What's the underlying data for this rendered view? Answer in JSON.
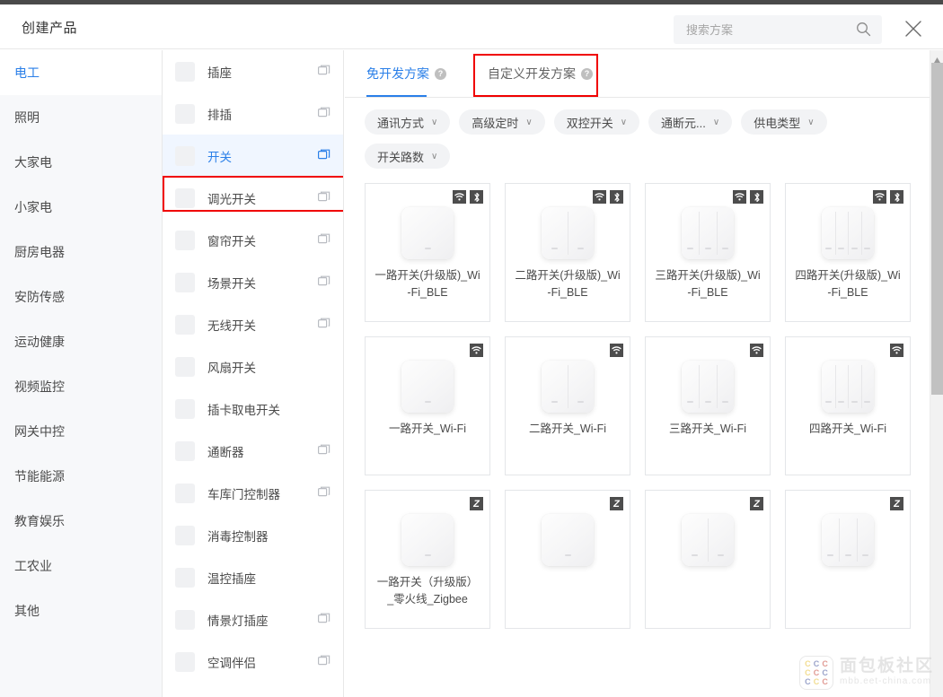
{
  "header": {
    "title": "创建产品",
    "search_placeholder": "搜索方案",
    "search_value": "",
    "search_icon": "search-icon",
    "close_icon": "close-icon"
  },
  "sidebar": {
    "items": [
      {
        "label": "电工",
        "active": true
      },
      {
        "label": "照明",
        "active": false
      },
      {
        "label": "大家电",
        "active": false
      },
      {
        "label": "小家电",
        "active": false
      },
      {
        "label": "厨房电器",
        "active": false
      },
      {
        "label": "安防传感",
        "active": false
      },
      {
        "label": "运动健康",
        "active": false
      },
      {
        "label": "视频监控",
        "active": false
      },
      {
        "label": "网关中控",
        "active": false
      },
      {
        "label": "节能能源",
        "active": false
      },
      {
        "label": "教育娱乐",
        "active": false
      },
      {
        "label": "工农业",
        "active": false
      },
      {
        "label": "其他",
        "active": false
      }
    ]
  },
  "categories": {
    "highlight_index": 2,
    "items": [
      {
        "label": "插座",
        "active": false,
        "has_copy": true
      },
      {
        "label": "排插",
        "active": false,
        "has_copy": true
      },
      {
        "label": "开关",
        "active": true,
        "has_copy": true
      },
      {
        "label": "调光开关",
        "active": false,
        "has_copy": true
      },
      {
        "label": "窗帘开关",
        "active": false,
        "has_copy": true
      },
      {
        "label": "场景开关",
        "active": false,
        "has_copy": true
      },
      {
        "label": "无线开关",
        "active": false,
        "has_copy": true
      },
      {
        "label": "风扇开关",
        "active": false,
        "has_copy": false
      },
      {
        "label": "插卡取电开关",
        "active": false,
        "has_copy": false
      },
      {
        "label": "通断器",
        "active": false,
        "has_copy": true
      },
      {
        "label": "车库门控制器",
        "active": false,
        "has_copy": true
      },
      {
        "label": "消毒控制器",
        "active": false,
        "has_copy": false
      },
      {
        "label": "温控插座",
        "active": false,
        "has_copy": false
      },
      {
        "label": "情景灯插座",
        "active": false,
        "has_copy": true
      },
      {
        "label": "空调伴侣",
        "active": false,
        "has_copy": true
      }
    ]
  },
  "tabs": [
    {
      "label": "免开发方案",
      "active": true,
      "help_icon": "question-icon",
      "highlighted": false
    },
    {
      "label": "自定义开发方案",
      "active": false,
      "help_icon": "question-icon",
      "highlighted": true
    }
  ],
  "filters": [
    {
      "label": "通讯方式"
    },
    {
      "label": "高级定时"
    },
    {
      "label": "双控开关"
    },
    {
      "label": "通断元..."
    },
    {
      "label": "供电类型"
    },
    {
      "label": "开关路数"
    }
  ],
  "products": [
    {
      "name": "一路开关(升级版)_Wi-Fi_BLE",
      "gangs": 1,
      "badges": [
        "wifi",
        "bluetooth"
      ]
    },
    {
      "name": "二路开关(升级版)_Wi-Fi_BLE",
      "gangs": 2,
      "badges": [
        "wifi",
        "bluetooth"
      ]
    },
    {
      "name": "三路开关(升级版)_Wi-Fi_BLE",
      "gangs": 3,
      "badges": [
        "wifi",
        "bluetooth"
      ]
    },
    {
      "name": "四路开关(升级版)_Wi-Fi_BLE",
      "gangs": 4,
      "badges": [
        "wifi",
        "bluetooth"
      ]
    },
    {
      "name": "一路开关_Wi-Fi",
      "gangs": 1,
      "badges": [
        "wifi"
      ]
    },
    {
      "name": "二路开关_Wi-Fi",
      "gangs": 2,
      "badges": [
        "wifi"
      ]
    },
    {
      "name": "三路开关_Wi-Fi",
      "gangs": 3,
      "badges": [
        "wifi"
      ]
    },
    {
      "name": "四路开关_Wi-Fi",
      "gangs": 4,
      "badges": [
        "wifi"
      ]
    },
    {
      "name": "一路开关（升级版）_零火线_Zigbee",
      "gangs": 1,
      "badges": [
        "zigbee"
      ]
    },
    {
      "name": "",
      "gangs": 1,
      "badges": [
        "zigbee"
      ]
    },
    {
      "name": "",
      "gangs": 2,
      "badges": [
        "zigbee"
      ]
    },
    {
      "name": "",
      "gangs": 3,
      "badges": [
        "zigbee"
      ]
    }
  ],
  "watermark": {
    "cn": "面包板社区",
    "en": "mbb.eet-china.com"
  },
  "colors": {
    "accent": "#2a7fe8",
    "annotation": "#f00000",
    "panel_bg": "#f7f8fa",
    "badge_bg": "#4d4d4d"
  }
}
